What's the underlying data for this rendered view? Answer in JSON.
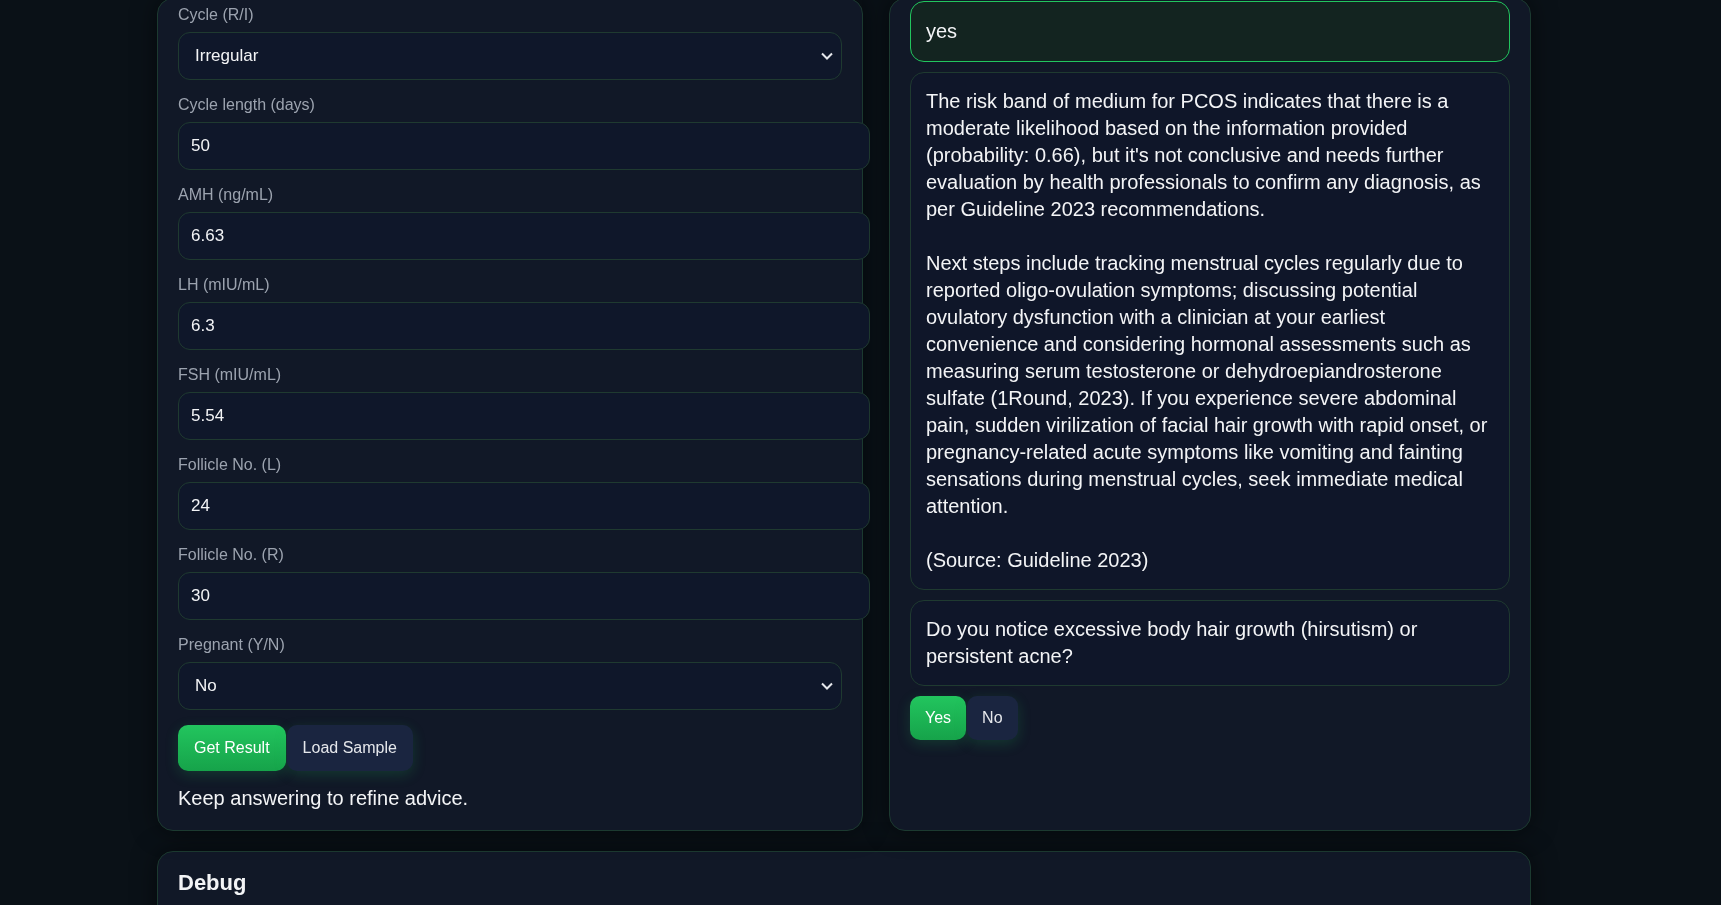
{
  "form": {
    "fields": [
      {
        "label": "Cycle (R/I)",
        "kind": "select",
        "value": "Irregular"
      },
      {
        "label": "Cycle length (days)",
        "kind": "number",
        "value": "50"
      },
      {
        "label": "AMH (ng/mL)",
        "kind": "number",
        "value": "6.63"
      },
      {
        "label": "LH (mIU/mL)",
        "kind": "number",
        "value": "6.3"
      },
      {
        "label": "FSH (mIU/mL)",
        "kind": "number",
        "value": "5.54"
      },
      {
        "label": "Follicle No. (L)",
        "kind": "number",
        "value": "24"
      },
      {
        "label": "Follicle No. (R)",
        "kind": "number",
        "value": "30"
      },
      {
        "label": "Pregnant (Y/N)",
        "kind": "select",
        "value": "No"
      }
    ],
    "buttons": [
      {
        "label": "Get Result",
        "kind": "primary"
      },
      {
        "label": "Load Sample",
        "kind": "secondary"
      }
    ],
    "status": "Keep answering to refine advice."
  },
  "chat": {
    "messages": [
      {
        "kind": "user",
        "text": "yes"
      },
      {
        "kind": "assistant",
        "text": "The risk band of medium for PCOS indicates that there is a moderate likelihood based on the information provided (probability: 0.66), but it's not conclusive and needs further evaluation by health professionals to confirm any diagnosis, as per Guideline 2023 recommendations.\n\nNext steps include tracking menstrual cycles regularly due to reported oligo-ovulation symptoms; discussing potential ovulatory dysfunction with a clinician at your earliest convenience and considering hormonal assessments such as measuring serum testosterone or dehydroepiandrosterone sulfate (1Round, 2023). If you experience severe abdominal pain, sudden virilization of facial hair growth with rapid onset, or pregnancy-related acute symptoms like vomiting and fainting sensations during menstrual cycles, seek immediate medical attention.\n\n(Source: Guideline 2023)"
      },
      {
        "kind": "assistant",
        "text": "Do you notice excessive body hair growth (hirsutism) or persistent acne?"
      }
    ],
    "answers": [
      {
        "label": "Yes",
        "kind": "primary"
      },
      {
        "label": "No",
        "kind": "secondary"
      }
    ]
  },
  "debug": {
    "title": "Debug"
  }
}
